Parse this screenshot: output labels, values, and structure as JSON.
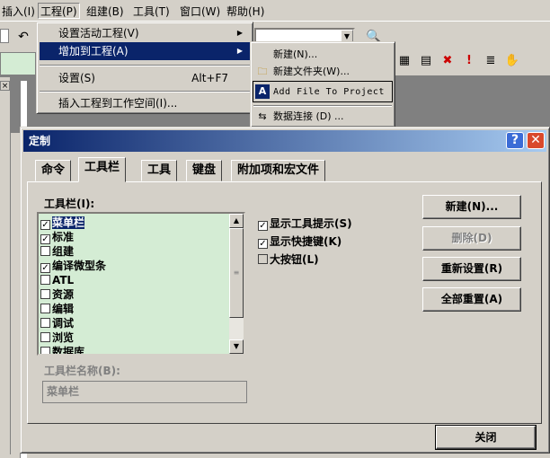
{
  "menubar": {
    "items": [
      "插入(I)",
      "工程(P)",
      "组建(B)",
      "工具(T)",
      "窗口(W)",
      "帮助(H)"
    ]
  },
  "project_menu": {
    "items": [
      {
        "label": "设置活动工程(V)",
        "arrow": "▶"
      },
      {
        "label": "增加到工程(A)",
        "arrow": "▶"
      },
      {
        "label": "设置(S)",
        "accel": "Alt+F7"
      },
      {
        "label": "插入工程到工作空间(I)..."
      }
    ]
  },
  "add_submenu": {
    "items": [
      {
        "label": "新建(N)...",
        "icon": "new-icon"
      },
      {
        "label": "新建文件夹(W)...",
        "icon": "folder-icon"
      },
      {
        "label": "Add File To Project",
        "icon": "add-file-icon"
      },
      {
        "label": "数据连接 (D) ...",
        "icon": "data-connection-icon"
      }
    ]
  },
  "dialog": {
    "title": "定制",
    "tabs": [
      "命令",
      "工具栏",
      "工具",
      "键盘",
      "附加项和宏文件"
    ],
    "active_tab": "工具栏",
    "toolbars_label": "工具栏(I):",
    "toolbars": [
      {
        "label": "菜单栏",
        "checked": true,
        "selected": true
      },
      {
        "label": "标准",
        "checked": true
      },
      {
        "label": "组建",
        "checked": false
      },
      {
        "label": "编译微型条",
        "checked": true
      },
      {
        "label": "ATL",
        "checked": false
      },
      {
        "label": "资源",
        "checked": false
      },
      {
        "label": "编辑",
        "checked": false
      },
      {
        "label": "调试",
        "checked": false
      },
      {
        "label": "浏览",
        "checked": false
      },
      {
        "label": "数据库",
        "checked": false
      }
    ],
    "toolbar_name_label": "工具栏名称(B):",
    "toolbar_name_value": "菜单栏",
    "options": [
      {
        "label": "显示工具提示(S)",
        "checked": true
      },
      {
        "label": "显示快捷键(K)",
        "checked": true
      },
      {
        "label": "大按钮(L)",
        "checked": false
      }
    ],
    "buttons": {
      "new": "新建(N)...",
      "delete": "删除(D)",
      "reset": "重新设置(R)",
      "reset_all": "全部重置(A)",
      "close": "关闭"
    }
  },
  "colors": {
    "titlebar_start": "#0a246a",
    "titlebar_end": "#a6caf0",
    "list_bg": "#d4ecd4",
    "face": "#d4d0c8"
  }
}
